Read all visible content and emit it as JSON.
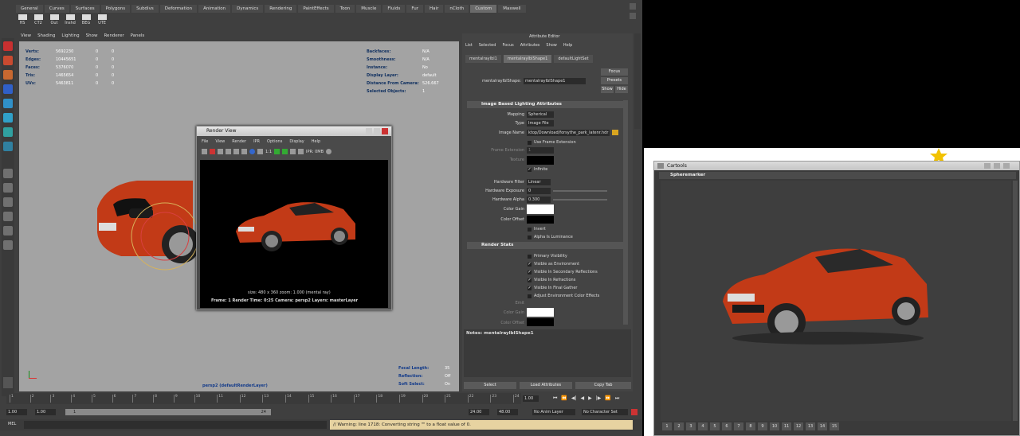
{
  "maya": {
    "shelf_tabs": [
      "General",
      "Curves",
      "Surfaces",
      "Polygons",
      "Subdivs",
      "Deformation",
      "Animation",
      "Dynamics",
      "Rendering",
      "PaintEffects",
      "Toon",
      "Muscle",
      "Fluids",
      "Fur",
      "Hair",
      "nCloth",
      "Custom",
      "Maxwell"
    ],
    "active_shelf_tab": "Custom",
    "shelf_icons": [
      "HS",
      "CT2",
      "Out",
      "Inshd",
      "BEG",
      "UTE"
    ],
    "viewport_menu": [
      "View",
      "Shading",
      "Lighting",
      "Show",
      "Renderer",
      "Panels"
    ],
    "hud_left": [
      {
        "label": "Verts:",
        "v1": "5692230",
        "v2": "0",
        "v3": "0"
      },
      {
        "label": "Edges:",
        "v1": "10445651",
        "v2": "0",
        "v3": "0"
      },
      {
        "label": "Faces:",
        "v1": "5376070",
        "v2": "0",
        "v3": "0"
      },
      {
        "label": "Tris:",
        "v1": "1465654",
        "v2": "0",
        "v3": "0"
      },
      {
        "label": "UVs:",
        "v1": "5463811",
        "v2": "0",
        "v3": "0"
      }
    ],
    "hud_right": [
      {
        "label": "Backfaces:",
        "value": "N/A"
      },
      {
        "label": "Smoothness:",
        "value": "N/A"
      },
      {
        "label": "Instance:",
        "value": "No"
      },
      {
        "label": "Display Layer:",
        "value": "default"
      },
      {
        "label": "Distance From Camera:",
        "value": "526.667"
      },
      {
        "label": "Selected Objects:",
        "value": "1"
      }
    ],
    "hud_bottom": [
      {
        "label": "Focal Length:",
        "value": "35"
      },
      {
        "label": "Reflection:",
        "value": "Off"
      },
      {
        "label": "Soft Select:",
        "value": "On"
      }
    ],
    "camera_label": "persp2 (defaultRenderLayer)",
    "render_view": {
      "title": "Render View",
      "menu": [
        "File",
        "View",
        "Render",
        "IPR",
        "Options",
        "Display",
        "Help"
      ],
      "zoom": "1:1",
      "ipr": "IPR: 0MB",
      "info_line1": "size: 480 x 360 zoom: 1.000      (mental ray)",
      "info_line2": "Frame: 1     Render Time: 0:25     Camera: persp2     Layers: masterLayer"
    },
    "attribute_editor": {
      "title": "Attribute Editor",
      "menu": [
        "List",
        "Selected",
        "Focus",
        "Attributes",
        "Show",
        "Help"
      ],
      "tabs": [
        "mentalrayIbl1",
        "mentalrayIblShape1",
        "defaultLightSet"
      ],
      "name_label": "mentalrayIblShape:",
      "name_value": "mentalrayIblShape1",
      "buttons": [
        "Focus",
        "Presets",
        "Show",
        "Hide"
      ],
      "section1": "Image Based Lighting Attributes",
      "mapping_label": "Mapping",
      "mapping_value": "Spherical",
      "type_label": "Type",
      "type_value": "Image File",
      "image_name_label": "Image Name",
      "image_name_value": "ktop/Download/forsythe_park_latenr.hdr",
      "use_frame_ext": "Use Frame Extension",
      "frame_ext_label": "Frame Extension",
      "frame_ext_value": "1",
      "texture_label": "Texture",
      "infinite": "Infinite",
      "hw_filter_label": "Hardware Filter",
      "hw_filter_value": "Linear",
      "hw_exposure_label": "Hardware Exposure",
      "hw_exposure_value": "0",
      "hw_alpha_label": "Hardware Alpha",
      "hw_alpha_value": "0.300",
      "color_gain_label": "Color Gain",
      "color_offset_label": "Color Offset",
      "invert": "Invert",
      "alpha_lum": "Alpha Is Luminance",
      "section2": "Render Stats",
      "stats": [
        {
          "label": "Primary Visibility",
          "checked": false
        },
        {
          "label": "Visible as Environment",
          "checked": true
        },
        {
          "label": "Visible In Secondary Reflections",
          "checked": true
        },
        {
          "label": "Visible In Refractions",
          "checked": true
        },
        {
          "label": "Visible In Final Gather",
          "checked": true
        },
        {
          "label": "Adjust Environment Color Effects",
          "checked": false
        }
      ],
      "emit_label": "Emit",
      "color_gain2": "Color Gain",
      "color_offset2": "Color Offset",
      "notes": "Notes: mentalrayIblShape1",
      "bottom_buttons": [
        "Select",
        "Load Attributes",
        "Copy Tab"
      ]
    },
    "time_ticks": [
      "1",
      "2",
      "3",
      "4",
      "5",
      "6",
      "7",
      "8",
      "9",
      "10",
      "11",
      "12",
      "13",
      "14",
      "15",
      "16",
      "17",
      "18",
      "19",
      "20",
      "21",
      "22",
      "23",
      "24"
    ],
    "current_frame": "1.00",
    "range": {
      "start1": "1.00",
      "start2": "1.00",
      "handle": "1",
      "end_tick": "24",
      "end1": "24.00",
      "end2": "48.00"
    },
    "anim_layer": "No Anim Layer",
    "char_set": "No Character Set",
    "cmd_label": "MEL",
    "warning": "// Warning: line 1718: Converting string \"\" to a float value of 0."
  },
  "cartools": {
    "title": "Cartools",
    "subtitle": "Spheremarker",
    "buttons": [
      "1",
      "2",
      "3",
      "4",
      "5",
      "6",
      "7",
      "8",
      "9",
      "10",
      "11",
      "12",
      "13",
      "14",
      "15"
    ]
  },
  "colors": {
    "car_red": "#c23a17",
    "viewport_bg": "#a3a3a3",
    "panel": "#444444",
    "warning_bg": "#e7d3a1",
    "star": "#f2c200"
  }
}
